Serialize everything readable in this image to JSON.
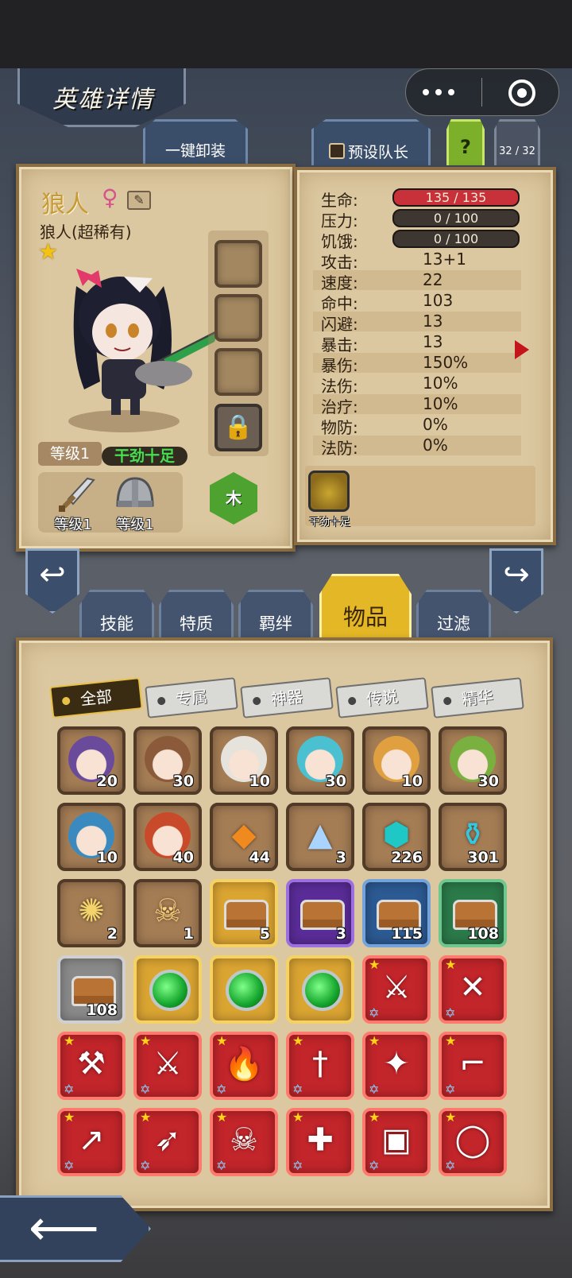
{
  "header": {
    "title": "英雄详情"
  },
  "capsule": {
    "more": "•••"
  },
  "top_tabs": {
    "unequip": "一键卸装",
    "preset_captain": "预设队长",
    "help": "?",
    "count": "32 / 32"
  },
  "hero": {
    "name": "狼人",
    "gender_symbol": "♀",
    "rarity": "狼人(超稀有)",
    "level": "等级1",
    "trait": "干劲十足",
    "element": "木",
    "gear": [
      {
        "icon": "sword-icon",
        "label": "等级1"
      },
      {
        "icon": "helmet-icon",
        "label": "等级1"
      }
    ]
  },
  "stats": {
    "hp": {
      "label": "生命:",
      "value": "135 / 135"
    },
    "stress": {
      "label": "压力:",
      "value": "0 / 100"
    },
    "hunger": {
      "label": "饥饿:",
      "value": "0 / 100"
    },
    "rows": [
      {
        "label": "攻击:",
        "value": "13+1"
      },
      {
        "label": "速度:",
        "value": "22"
      },
      {
        "label": "命中:",
        "value": "103"
      },
      {
        "label": "闪避:",
        "value": "13"
      },
      {
        "label": "暴击:",
        "value": "13"
      },
      {
        "label": "暴伤:",
        "value": "150%"
      },
      {
        "label": "法伤:",
        "value": "10%"
      },
      {
        "label": "治疗:",
        "value": "10%"
      },
      {
        "label": "物防:",
        "value": "0%"
      },
      {
        "label": "法防:",
        "value": "0%"
      }
    ],
    "skill_label": "干劲十足"
  },
  "category_tabs": [
    "技能",
    "特质",
    "羁绊",
    "物品",
    "过滤"
  ],
  "filters": [
    "全部",
    "专属",
    "神器",
    "传说",
    "精华"
  ],
  "items": [
    {
      "kind": "hero",
      "icon": "samurai-hero-icon",
      "qty": "20"
    },
    {
      "kind": "hero",
      "icon": "valkyrie-hero-icon",
      "qty": "30"
    },
    {
      "kind": "hero",
      "icon": "white-hair-hero-icon",
      "qty": "10"
    },
    {
      "kind": "hero",
      "icon": "elf-hero-icon",
      "qty": "30"
    },
    {
      "kind": "hero",
      "icon": "blonde-hero-icon",
      "qty": "10"
    },
    {
      "kind": "hero",
      "icon": "green-hair-hero-icon",
      "qty": "30"
    },
    {
      "kind": "hero",
      "icon": "blue-hair-hero-icon",
      "qty": "10"
    },
    {
      "kind": "hero",
      "icon": "red-hair-hero-icon",
      "qty": "40"
    },
    {
      "kind": "material",
      "icon": "amber-crystal-icon",
      "qty": "44"
    },
    {
      "kind": "material",
      "icon": "salt-pile-icon",
      "qty": "3"
    },
    {
      "kind": "material",
      "icon": "rune-stone-icon",
      "qty": "226"
    },
    {
      "kind": "material",
      "icon": "potion-icon",
      "qty": "301"
    },
    {
      "kind": "material",
      "icon": "gold-scroll-icon",
      "qty": "2"
    },
    {
      "kind": "material",
      "icon": "skull-hood-icon",
      "qty": "1"
    },
    {
      "kind": "chest",
      "icon": "gold-chest-icon",
      "qty": "5"
    },
    {
      "kind": "chest",
      "icon": "purple-chest-icon",
      "qty": "3"
    },
    {
      "kind": "chest",
      "icon": "blue-chest-icon",
      "qty": "115"
    },
    {
      "kind": "chest",
      "icon": "green-chest-icon",
      "qty": "108"
    },
    {
      "kind": "chest",
      "icon": "gray-chest-icon",
      "qty": "108"
    },
    {
      "kind": "gem",
      "icon": "green-gem-icon",
      "qty": ""
    },
    {
      "kind": "gem",
      "icon": "green-gem-icon",
      "qty": ""
    },
    {
      "kind": "gem",
      "icon": "green-gem-icon",
      "qty": ""
    },
    {
      "kind": "weapon",
      "icon": "battle-axe-icon",
      "qty": ""
    },
    {
      "kind": "weapon",
      "icon": "crossed-blades-icon",
      "qty": ""
    },
    {
      "kind": "weapon",
      "icon": "double-axe-icon",
      "qty": ""
    },
    {
      "kind": "weapon",
      "icon": "broadsword-icon",
      "qty": ""
    },
    {
      "kind": "weapon",
      "icon": "flame-sword-icon",
      "qty": ""
    },
    {
      "kind": "weapon",
      "icon": "dagger-icon",
      "qty": ""
    },
    {
      "kind": "weapon",
      "icon": "spellbook-icon",
      "qty": ""
    },
    {
      "kind": "weapon",
      "icon": "pistol-icon",
      "qty": ""
    },
    {
      "kind": "weapon",
      "icon": "golden-spear-icon",
      "qty": ""
    },
    {
      "kind": "weapon",
      "icon": "drill-lance-icon",
      "qty": ""
    },
    {
      "kind": "weapon",
      "icon": "skull-cloak-icon",
      "qty": ""
    },
    {
      "kind": "weapon",
      "icon": "medkit-icon",
      "qty": ""
    },
    {
      "kind": "weapon",
      "icon": "backpack-icon",
      "qty": ""
    },
    {
      "kind": "weapon",
      "icon": "crystal-ring-icon",
      "qty": ""
    }
  ],
  "colors": {
    "accent_gold": "#e3b726",
    "panel_parchment": "#dcc8a0",
    "hp_bar": "#c8313a",
    "trait_green": "#44e050",
    "rare_red": "#c2252a"
  }
}
